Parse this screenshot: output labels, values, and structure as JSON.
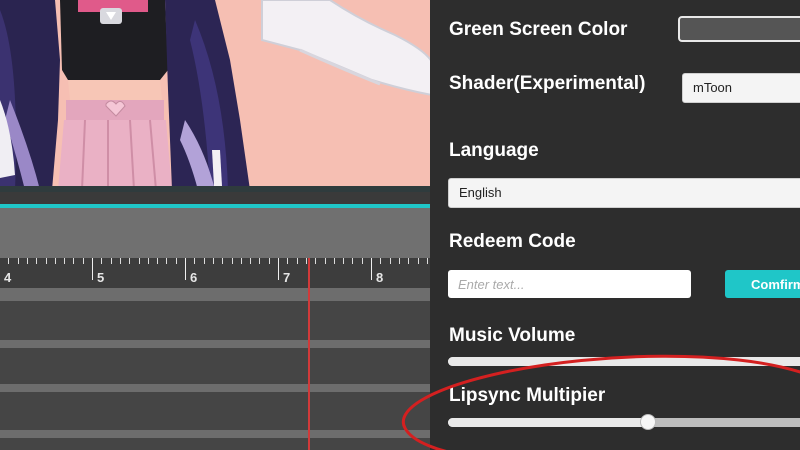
{
  "timeline": {
    "ruler_labels": [
      "4",
      "5",
      "6",
      "7",
      "8"
    ]
  },
  "settings": {
    "green_screen_label": "Green Screen Color",
    "green_screen_color": "#555555",
    "shader_label": "Shader(Experimental)",
    "shader_value": "mToon",
    "language_label": "Language",
    "language_value": "English",
    "redeem_label": "Redeem Code",
    "redeem_placeholder": "Enter text...",
    "confirm_label": "Comfirm",
    "music_volume_label": "Music Volume",
    "music_volume": 1.0,
    "lipsync_label": "Lipsync Multipier",
    "lipsync_value": 0.54
  },
  "colors": {
    "accent": "#1fc6c8",
    "playhead": "#d23a3a",
    "annotation": "#d42020"
  },
  "icons": {
    "character": "avatar-character-illustration"
  }
}
